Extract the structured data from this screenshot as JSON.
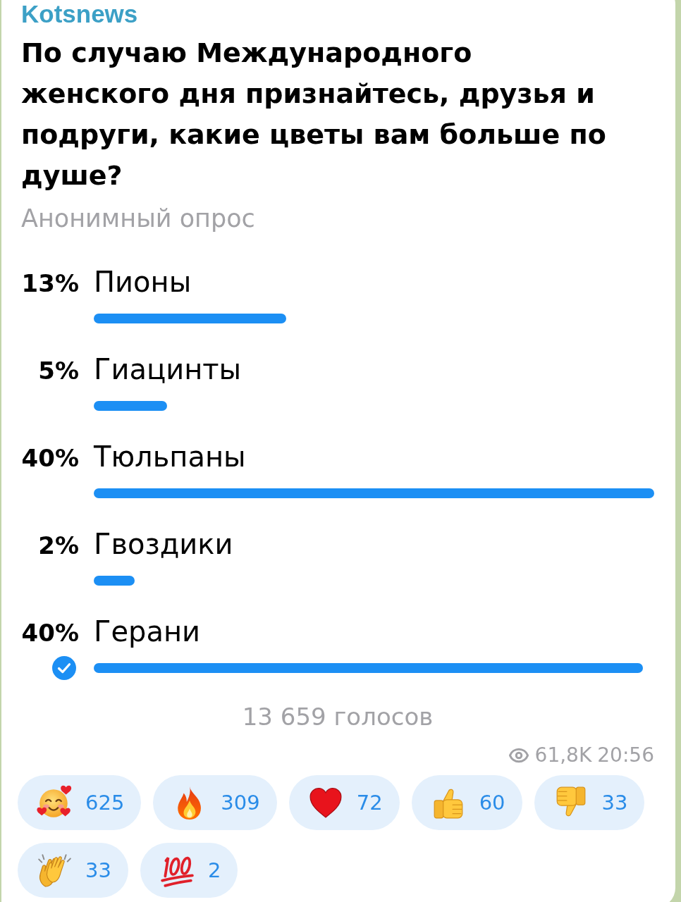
{
  "channel": {
    "name": "Kotsnews"
  },
  "poll": {
    "question": "По случаю Международного женского дня признайтесь, друзья и подруги, какие цветы вам больше по душе?",
    "type_label": "Анонимный опрос",
    "options": [
      {
        "percent": "13%",
        "label": "Пионы",
        "level": 0.344,
        "selected": false
      },
      {
        "percent": "5%",
        "label": "Гиацинты",
        "level": 0.131,
        "selected": false
      },
      {
        "percent": "40%",
        "label": "Тюльпаны",
        "level": 1,
        "selected": false
      },
      {
        "percent": "2%",
        "label": "Гвоздики",
        "level": 0.073,
        "selected": false
      },
      {
        "percent": "40%",
        "label": "Герани",
        "level": 0.98,
        "selected": true
      }
    ],
    "total_votes": "13 659 голосов"
  },
  "meta": {
    "views": "61,8K",
    "time": "20:56"
  },
  "reactions": [
    {
      "kind": "smiling_hearts",
      "count": "625"
    },
    {
      "kind": "fire",
      "count": "309"
    },
    {
      "kind": "heart",
      "count": "72"
    },
    {
      "kind": "thumbs_up",
      "count": "60"
    },
    {
      "kind": "thumbs_down",
      "count": "33"
    },
    {
      "kind": "clapping",
      "count": "33"
    },
    {
      "kind": "hundred",
      "count": "2"
    }
  ]
}
